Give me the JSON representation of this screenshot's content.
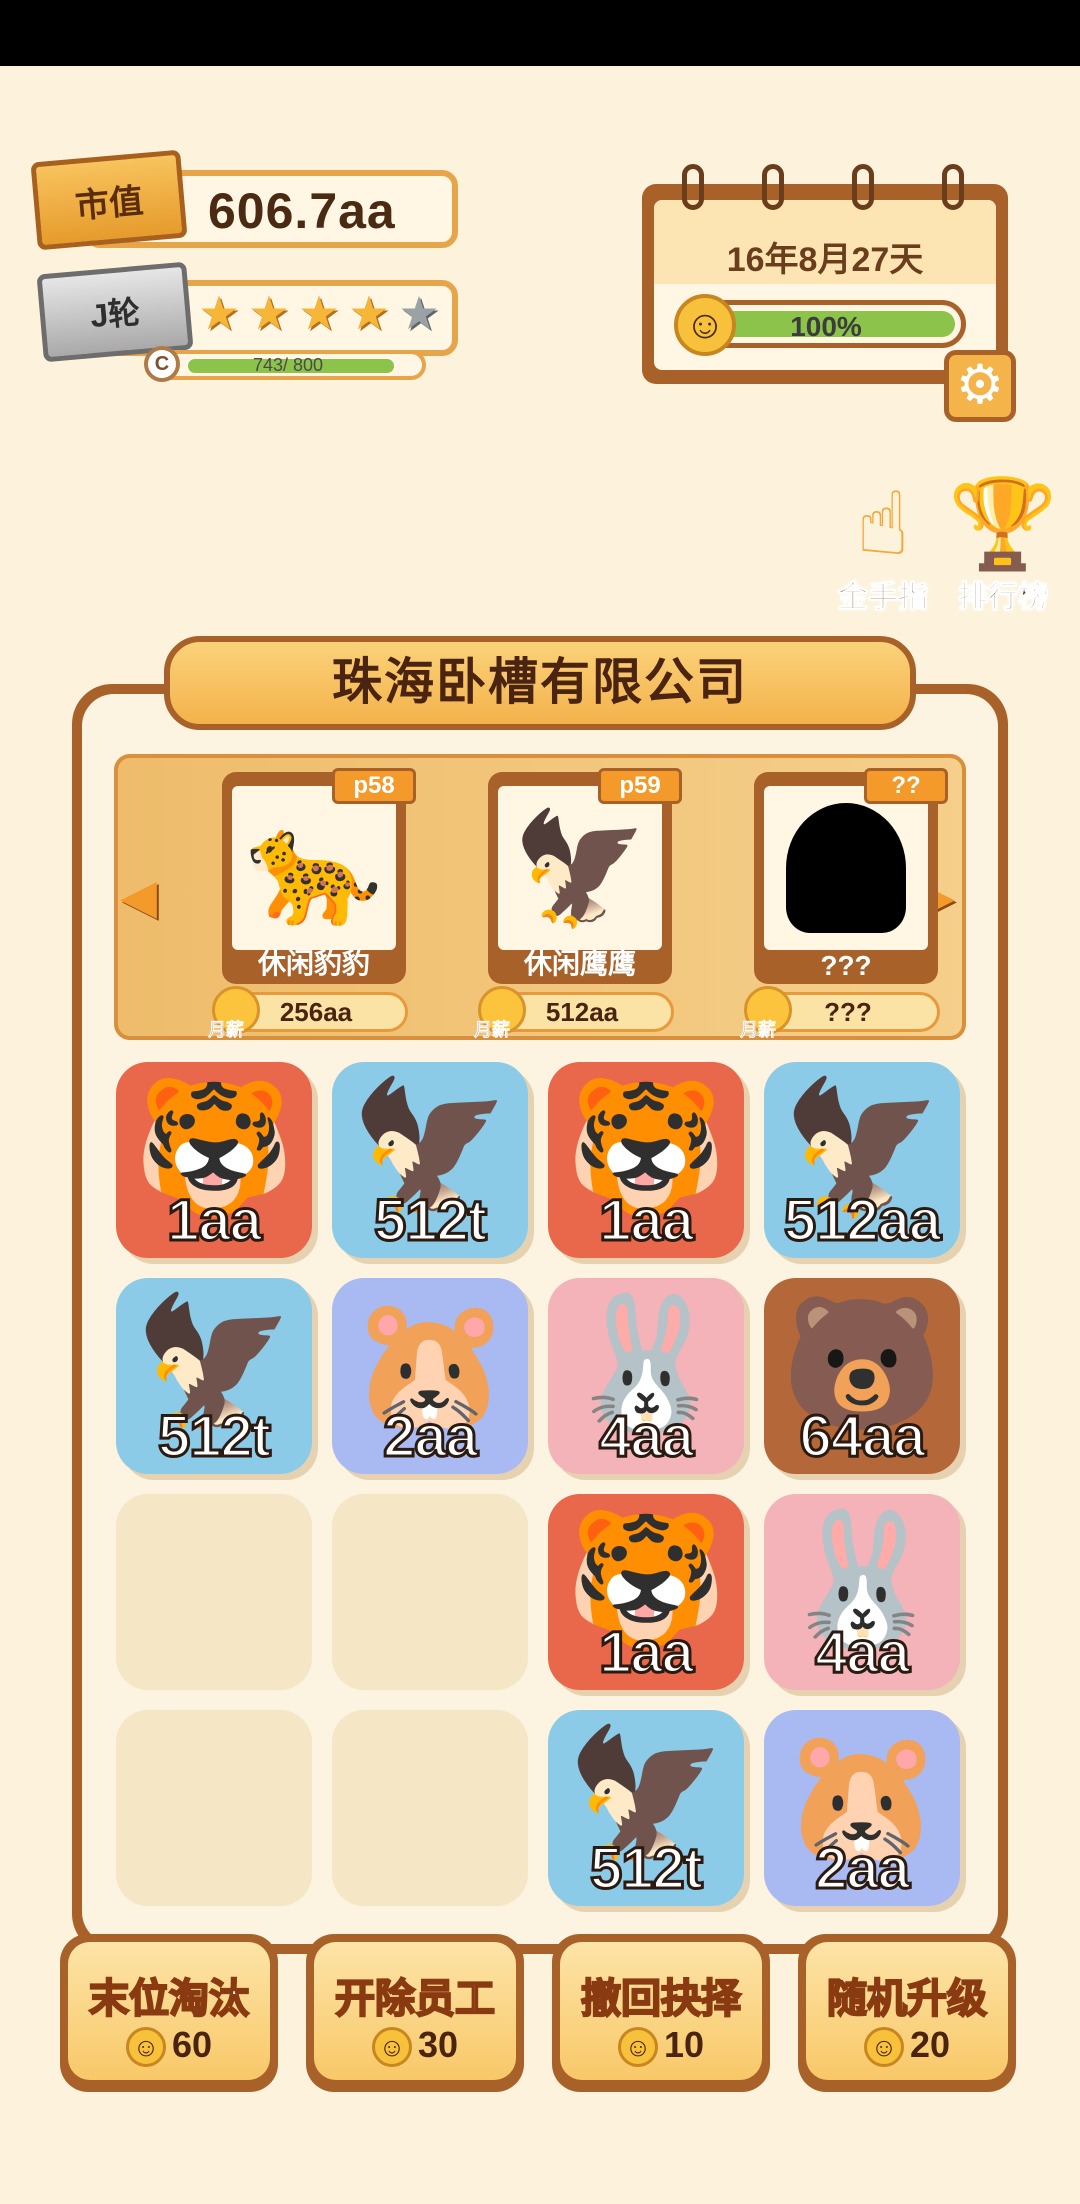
{
  "stats": {
    "market_badge": "市值",
    "market_value": "606.7aa",
    "round_badge": "J轮",
    "stars_filled": 4,
    "stars_total": 5,
    "xp_text": "743/ 800",
    "xp_fraction": 0.929,
    "xp_coin": "C"
  },
  "calendar": {
    "date": "16年8月27天",
    "mood_percent": "100%",
    "mood_fraction": 1.0
  },
  "side": {
    "golden_finger_label": "金手指",
    "leaderboard_label": "排行榜"
  },
  "company": {
    "title": "珠海卧槽有限公司"
  },
  "carousel": {
    "salary_label": "月薪",
    "cards": [
      {
        "tag": "p58",
        "name": "休闲豹豹",
        "salary": "256aa",
        "icon": "leopard"
      },
      {
        "tag": "p59",
        "name": "休闲鹰鹰",
        "salary": "512aa",
        "icon": "eagle"
      },
      {
        "tag": "??",
        "name": "???",
        "salary": "???",
        "icon": "silhouette"
      }
    ]
  },
  "grid": {
    "tiles": [
      {
        "animal": "tiger",
        "value": "1aa"
      },
      {
        "animal": "eagle",
        "value": "512t"
      },
      {
        "animal": "tiger",
        "value": "1aa"
      },
      {
        "animal": "eagle",
        "value": "512aa"
      },
      {
        "animal": "eagle",
        "value": "512t"
      },
      {
        "animal": "hamster",
        "value": "2aa"
      },
      {
        "animal": "rabbit",
        "value": "4aa"
      },
      {
        "animal": "bear",
        "value": "64aa"
      },
      {
        "animal": "empty",
        "value": ""
      },
      {
        "animal": "empty",
        "value": ""
      },
      {
        "animal": "tiger",
        "value": "1aa"
      },
      {
        "animal": "rabbit",
        "value": "4aa"
      },
      {
        "animal": "empty",
        "value": ""
      },
      {
        "animal": "empty",
        "value": ""
      },
      {
        "animal": "eagle",
        "value": "512t"
      },
      {
        "animal": "hamster",
        "value": "2aa"
      }
    ]
  },
  "actions": [
    {
      "label": "末位淘汰",
      "cost": "60"
    },
    {
      "label": "开除员工",
      "cost": "30"
    },
    {
      "label": "撤回抉择",
      "cost": "10"
    },
    {
      "label": "随机升级",
      "cost": "20"
    }
  ],
  "colors": {
    "background": "#fdf3dc",
    "brown_border": "#a9612a",
    "orange_accent": "#f39a2a",
    "green_progress": "#8cc34a"
  }
}
